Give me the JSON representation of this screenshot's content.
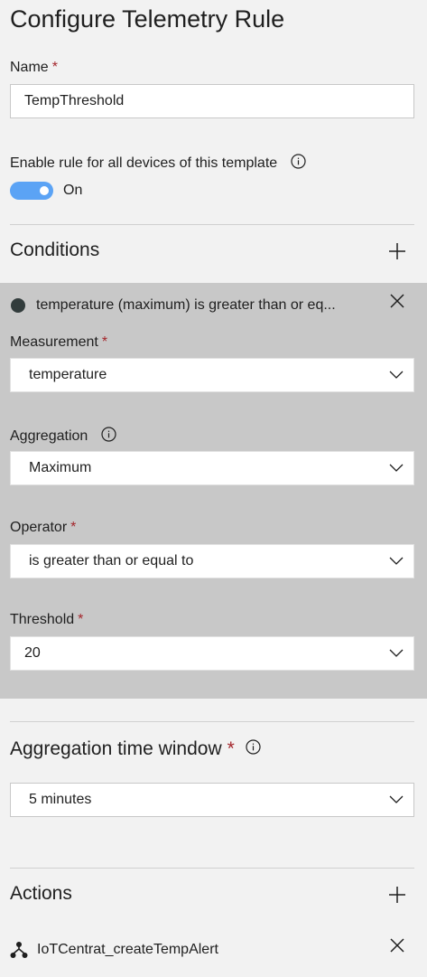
{
  "title": "Configure Telemetry Rule",
  "name_field": {
    "label": "Name",
    "required_mark": "*",
    "value": "TempThreshold"
  },
  "enable_rule": {
    "label": "Enable rule for all devices of this template",
    "state_label": "On",
    "enabled": true
  },
  "conditions": {
    "title": "Conditions",
    "condition": {
      "summary": "temperature (maximum) is greater than or eq...",
      "measurement": {
        "label": "Measurement",
        "required_mark": "*",
        "value": "temperature"
      },
      "aggregation": {
        "label": "Aggregation",
        "value": "Maximum"
      },
      "operator": {
        "label": "Operator",
        "required_mark": "*",
        "value": "is greater than or equal to"
      },
      "threshold": {
        "label": "Threshold",
        "required_mark": "*",
        "value": "20"
      }
    }
  },
  "aggregation_window": {
    "label": "Aggregation time window",
    "required_mark": "*",
    "value": "5 minutes"
  },
  "actions": {
    "title": "Actions",
    "items": [
      {
        "label": "IoTCentrat_createTempAlert",
        "icon": "workflow-icon"
      }
    ]
  },
  "colors": {
    "accent": "#5ba3f5",
    "required": "#a4262c",
    "panel": "#c8c8c8",
    "background": "#f2f2f2"
  }
}
